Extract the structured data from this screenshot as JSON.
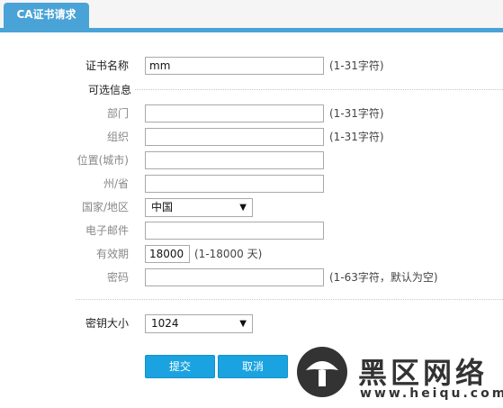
{
  "tab": {
    "title": "CA证书请求"
  },
  "form": {
    "cert_name": {
      "label": "证书名称",
      "value": "mm",
      "hint": "(1-31字符)"
    },
    "optional_section": "可选信息",
    "department": {
      "label": "部门",
      "value": "",
      "hint": "(1-31字符)"
    },
    "organization": {
      "label": "组织",
      "value": "",
      "hint": "(1-31字符)"
    },
    "city": {
      "label": "位置(城市)",
      "value": ""
    },
    "province": {
      "label": "州/省",
      "value": ""
    },
    "country": {
      "label": "国家/地区",
      "selected": "中国"
    },
    "email": {
      "label": "电子邮件",
      "value": ""
    },
    "validity": {
      "label": "有效期",
      "value": "18000",
      "hint": "(1-18000 天)"
    },
    "password": {
      "label": "密码",
      "value": "",
      "hint": "(1-63字符，默认为空)"
    },
    "key_size": {
      "label": "密钥大小",
      "selected": "1024"
    }
  },
  "buttons": {
    "submit": "提交",
    "cancel": "取消"
  },
  "watermark": {
    "brand": "黑区网络",
    "url": "www.heiqu.com"
  },
  "colors": {
    "accent": "#4aa3d6",
    "button": "#1aa3e0"
  }
}
